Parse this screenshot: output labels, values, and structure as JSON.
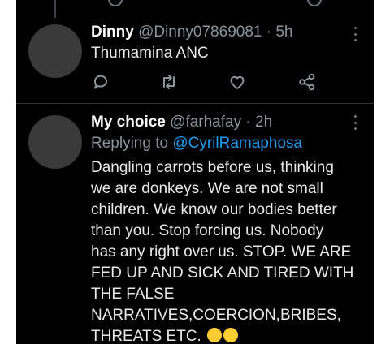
{
  "tweets": [
    {
      "name": "Dinny",
      "handle": "@Dinny07869081",
      "sep": " · ",
      "time": "5h",
      "text": "Thumamina ANC"
    },
    {
      "name": "My choice",
      "handle": "@farhafay",
      "sep": " · ",
      "time": "2h",
      "replying_prefix": "Replying to ",
      "replying_to": "@CyrilRamaphosa",
      "lines": [
        "Dangling carrots before us, thinking",
        "we are donkeys. We are not small",
        "children. We know our bodies better",
        "than you. Stop forcing us. Nobody",
        "has any right over us. STOP. WE ARE",
        "FED UP AND SICK AND TIRED WITH",
        "THE FALSE",
        "NARRATIVES,COERCION,BRIBES,",
        "THREATS ETC."
      ]
    }
  ],
  "icons": [
    "reply-icon",
    "retweet-icon",
    "like-icon",
    "share-icon",
    "more-icon",
    "weary-face-emoji"
  ],
  "colors": {
    "background": "#000000",
    "text": "#e7e9ea",
    "muted": "#8b949b",
    "link": "#1d9bf0",
    "divider": "#2f3336"
  }
}
